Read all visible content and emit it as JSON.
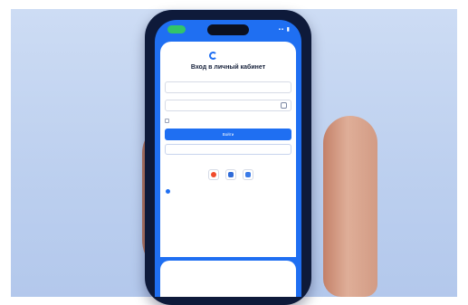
{
  "status_bar": {
    "time": "",
    "icons": "▪▪ ▮"
  },
  "brand": {
    "name": "",
    "accent_color": "#1f6ff2"
  },
  "login": {
    "title": "Вход в личный кабинет",
    "login_placeholder": "",
    "password_placeholder": "",
    "remember_label": "",
    "forgot_link": "",
    "submit_label": "Войти",
    "alt_button_label": "",
    "via_label": "",
    "social_icons": [
      "yandex-icon",
      "vk-icon",
      "gosuslugi-icon"
    ],
    "info_text": "",
    "support_link": ""
  },
  "footer": {
    "line1": "",
    "line2": ""
  }
}
